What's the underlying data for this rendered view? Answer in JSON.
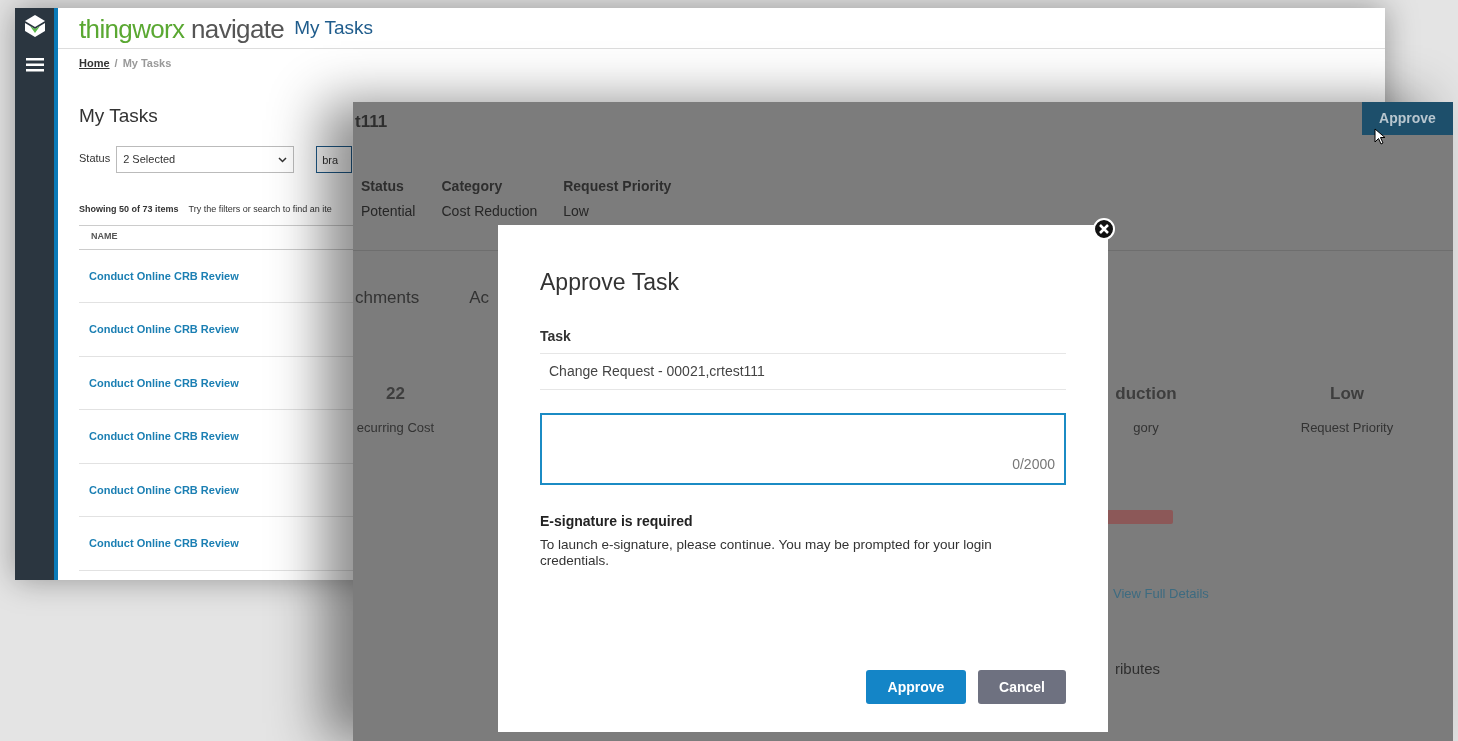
{
  "back_window": {
    "brand": {
      "part_1": "thingworx",
      "part_2": "navigate"
    },
    "header_title": "My Tasks",
    "breadcrumb": [
      "Home",
      "/",
      "My Tasks"
    ],
    "page_title": "My Tasks",
    "status_filter": {
      "label": "Status",
      "value": "2 Selected"
    },
    "search": {
      "value": "bra"
    },
    "summary": "Showing 50 of 73 items",
    "hint": "Try the filters or search to find an ite",
    "table": {
      "columns": [
        "NAME"
      ],
      "rows": [
        "Conduct Online CRB Review",
        "Conduct Online CRB Review",
        "Conduct Online CRB Review",
        "Conduct Online CRB Review",
        "Conduct Online CRB Review",
        "Conduct Online CRB Review"
      ]
    }
  },
  "front_window": {
    "title": "t111",
    "approve_button": "Approve",
    "fields": [
      {
        "label": "Status",
        "value": "Potential"
      },
      {
        "label": "Category",
        "value": "Cost Reduction"
      },
      {
        "label": "Request Priority",
        "value": "Low"
      }
    ],
    "tabs": [
      "chments",
      "Ac"
    ],
    "stats": [
      {
        "value": "22",
        "label": "ecurring Cost"
      },
      {
        "value": "duction",
        "label": "gory"
      },
      {
        "value": "Low",
        "label": "Request Priority"
      }
    ],
    "link": "View Full Details",
    "section": "ributes"
  },
  "dialog": {
    "title": "Approve Task",
    "task_label": "Task",
    "task_value": "Change Request - 00021,crtest111",
    "comment": {
      "counter": "0/2000"
    },
    "esign_title": "E-signature is required",
    "esign_text": "To launch e-signature, please continue. You may be prompted for your login credentials.",
    "buttons": [
      {
        "label": "Approve",
        "kind": "primary"
      },
      {
        "label": "Cancel",
        "kind": "secondary"
      }
    ]
  }
}
